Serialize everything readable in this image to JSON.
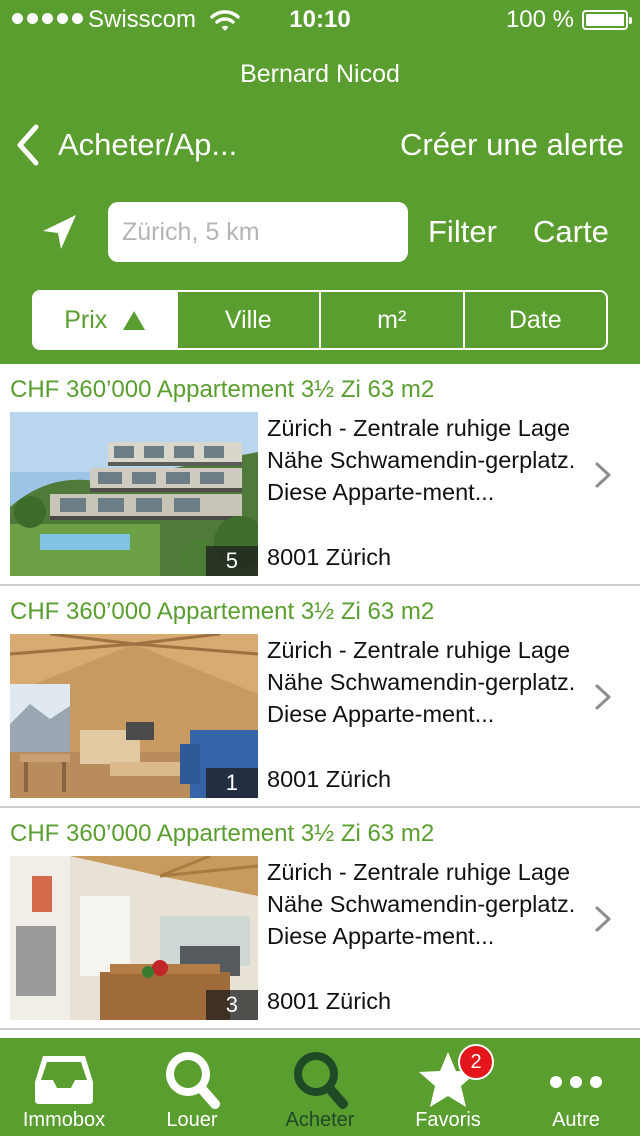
{
  "status": {
    "carrier": "Swisscom",
    "time": "10:10",
    "battery": "100 %"
  },
  "app_title": "Bernard Nicod",
  "nav": {
    "back_label": "Acheter/Ap...",
    "alert_label": "Créer une alerte"
  },
  "search": {
    "placeholder": "Zürich, 5 km",
    "filter_label": "Filter",
    "map_label": "Carte"
  },
  "sort": {
    "options": [
      "Prix",
      "Ville",
      "m²",
      "Date"
    ],
    "selected": "Prix",
    "direction": "ascending"
  },
  "listings": [
    {
      "title": "CHF 360’000 Appartement 3½ Zi 63 m2",
      "description": "Zürich - Zentrale ruhige Lage Nähe Schwamendin-gerplatz. Diese Apparte-ment...",
      "location": "8001 Zürich",
      "photo_count": "5"
    },
    {
      "title": "CHF 360’000 Appartement 3½ Zi 63 m2",
      "description": "Zürich - Zentrale ruhige Lage Nähe Schwamendin-gerplatz. Diese Apparte-ment...",
      "location": "8001 Zürich",
      "photo_count": "1"
    },
    {
      "title": "CHF 360’000 Appartement 3½ Zi 63 m2",
      "description": "Zürich - Zentrale ruhige Lage Nähe Schwamendin-gerplatz. Diese Apparte-ment...",
      "location": "8001 Zürich",
      "photo_count": "3"
    }
  ],
  "tabs": [
    {
      "label": "Immobox",
      "icon": "inbox-icon"
    },
    {
      "label": "Louer",
      "icon": "search-icon"
    },
    {
      "label": "Acheter",
      "icon": "search-icon",
      "active": true
    },
    {
      "label": "Favoris",
      "icon": "star-icon",
      "badge": "2"
    },
    {
      "label": "Autre",
      "icon": "more-icon"
    }
  ],
  "colors": {
    "brand_green": "#5a9e2f",
    "active_tab": "#1f4a26",
    "badge_red": "#e3171b"
  }
}
